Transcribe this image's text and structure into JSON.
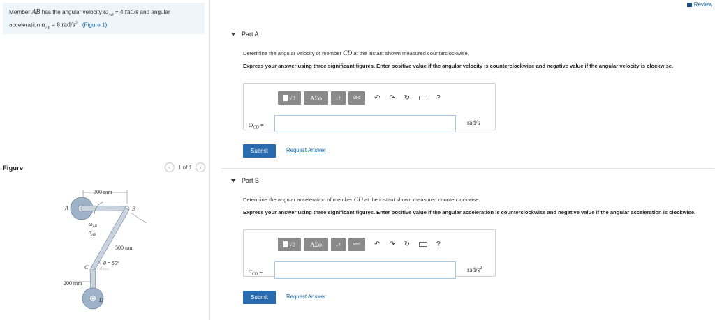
{
  "problem": {
    "text_1": "Member ",
    "member_ab": "AB",
    "text_2": " has the angular velocity ",
    "omega_ab": "ω",
    "omega_ab_sub": "AB",
    "omega_val": " = 4 ",
    "omega_unit": "rad/s",
    "text_3": " and angular",
    "text_4": "acceleration ",
    "alpha_ab": "α",
    "alpha_ab_sub": "AB",
    "alpha_val": " = 8 ",
    "alpha_unit": "rad/s",
    "alpha_exp": "2",
    "text_5": " . ",
    "figure_link": "(Figure 1)"
  },
  "review": "Review",
  "figure": {
    "title": "Figure",
    "pager_text": "1 of 1",
    "prev_icon": "chevron-left-icon",
    "next_icon": "chevron-right-icon",
    "labels": {
      "a": "A",
      "b": "B",
      "c": "C",
      "d": "D",
      "dim_top": "300 mm",
      "dim_side": "500 mm",
      "dim_bottom": "200 mm",
      "omega": "ω",
      "omega_sub": "AB",
      "alpha": "α",
      "alpha_sub": "AB",
      "theta": "θ = 60°"
    }
  },
  "partA": {
    "title": "Part A",
    "question_1": "Determine the angular velocity of member ",
    "member": "CD",
    "question_2": " at the instant shown measured counterclockwise.",
    "instruction": "Express your answer using three significant figures. Enter positive value if the angular velocity is counterclockwise and negative value if the angular velocity is clockwise.",
    "label_sym": "ω",
    "label_sub": "CD",
    "label_eq": " =",
    "unit": "rad/s",
    "submit": "Submit",
    "request": "Request Answer"
  },
  "partB": {
    "title": "Part B",
    "question_1": "Determine the angular acceleration of member ",
    "member": "CD",
    "question_2": " at the instant shown measured counterclockwise.",
    "instruction": "Express your answer using three significant figures. Enter positive value if the angular acceleration is counterclockwise and negative value if the angular acceleration is clockwise.",
    "label_sym": "α",
    "label_sub": "CD",
    "label_eq": " =",
    "unit": "rad/s",
    "unit_exp": "2",
    "submit": "Submit",
    "request": "Request Answer"
  },
  "toolbar": {
    "btn_templates": "√▯",
    "btn_symbols": "ΑΣφ",
    "btn_arrows": "↓↑",
    "btn_vec": "vec",
    "undo": "↶",
    "redo": "↷",
    "reset": "↻",
    "help": "?"
  }
}
